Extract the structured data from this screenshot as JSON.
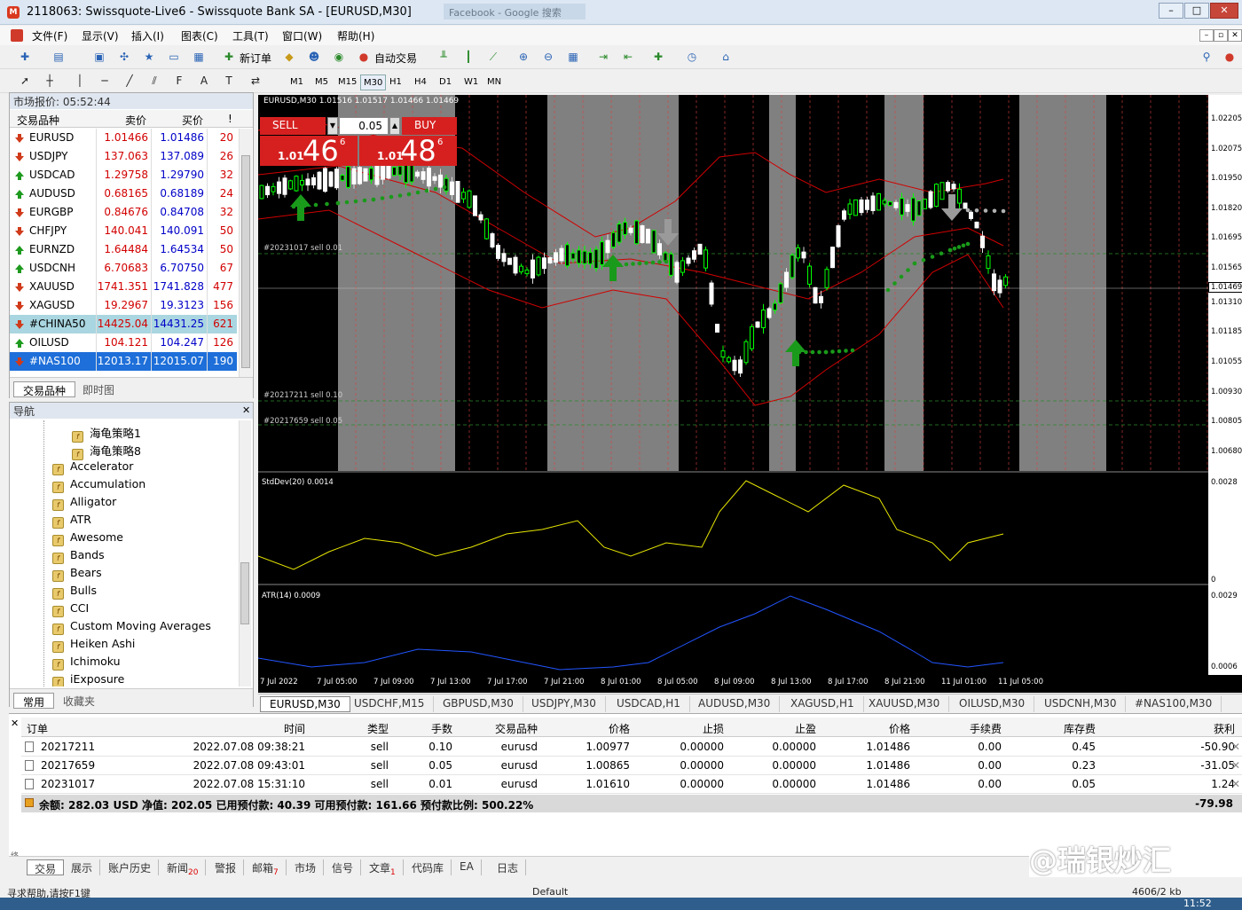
{
  "window": {
    "title": "2118063: Swissquote-Live6 - Swissquote Bank SA - [EURUSD,M30]",
    "ghost_tab": "Facebook - Google 搜索"
  },
  "menu": [
    "文件(F)",
    "显示(V)",
    "插入(I)",
    "图表(C)",
    "工具(T)",
    "窗口(W)",
    "帮助(H)"
  ],
  "toolbar": {
    "new_order": "新订单",
    "auto_trade": "自动交易"
  },
  "timeframes": [
    "M1",
    "M5",
    "M15",
    "M30",
    "H1",
    "H4",
    "D1",
    "W1",
    "MN"
  ],
  "active_timeframe": "M30",
  "market_watch": {
    "title": "市场报价: 05:52:44",
    "headers": [
      "交易品种",
      "卖价",
      "买价",
      "!"
    ],
    "rows": [
      {
        "symbol": "EURUSD",
        "bid": "1.01466",
        "ask": "1.01486",
        "spread": "20",
        "dir": "down"
      },
      {
        "symbol": "USDJPY",
        "bid": "137.063",
        "ask": "137.089",
        "spread": "26",
        "dir": "down"
      },
      {
        "symbol": "USDCAD",
        "bid": "1.29758",
        "ask": "1.29790",
        "spread": "32",
        "dir": "up"
      },
      {
        "symbol": "AUDUSD",
        "bid": "0.68165",
        "ask": "0.68189",
        "spread": "24",
        "dir": "up"
      },
      {
        "symbol": "EURGBP",
        "bid": "0.84676",
        "ask": "0.84708",
        "spread": "32",
        "dir": "down"
      },
      {
        "symbol": "CHFJPY",
        "bid": "140.041",
        "ask": "140.091",
        "spread": "50",
        "dir": "down"
      },
      {
        "symbol": "EURNZD",
        "bid": "1.64484",
        "ask": "1.64534",
        "spread": "50",
        "dir": "up"
      },
      {
        "symbol": "USDCNH",
        "bid": "6.70683",
        "ask": "6.70750",
        "spread": "67",
        "dir": "up"
      },
      {
        "symbol": "XAUUSD",
        "bid": "1741.351",
        "ask": "1741.828",
        "spread": "477",
        "dir": "down"
      },
      {
        "symbol": "XAGUSD",
        "bid": "19.2967",
        "ask": "19.3123",
        "spread": "156",
        "dir": "down"
      },
      {
        "symbol": "#CHINA50",
        "bid": "14425.04",
        "ask": "14431.25",
        "spread": "621",
        "dir": "down"
      },
      {
        "symbol": "OILUSD",
        "bid": "104.121",
        "ask": "104.247",
        "spread": "126",
        "dir": "up"
      },
      {
        "symbol": "#NAS100",
        "bid": "12013.17",
        "ask": "12015.07",
        "spread": "190",
        "dir": "down"
      }
    ],
    "tabs": [
      "交易品种",
      "即时图"
    ]
  },
  "navigator": {
    "title": "导航",
    "items": [
      "海龟策略1",
      "海龟策略8",
      "Accelerator",
      "Accumulation",
      "Alligator",
      "ATR",
      "Awesome",
      "Bands",
      "Bears",
      "Bulls",
      "CCI",
      "Custom Moving Averages",
      "Heiken Ashi",
      "Ichimoku",
      "iExposure"
    ],
    "tabs": [
      "常用",
      "收藏夹"
    ]
  },
  "chart": {
    "header": "EURUSD,M30  1.01516 1.01517 1.01466 1.01469",
    "sell_label": "SELL",
    "buy_label": "BUY",
    "lot": "0.05",
    "sell_small": "1.01",
    "sell_big": "46",
    "sell_sup": "6",
    "buy_small": "1.01",
    "buy_big": "48",
    "buy_sup": "6",
    "price_ticks": [
      "1.02205",
      "1.02075",
      "1.01950",
      "1.01820",
      "1.01695",
      "1.01565",
      "1.01310",
      "1.01185",
      "1.01055",
      "1.00930",
      "1.00805",
      "1.00680"
    ],
    "current_price": "1.01469",
    "order_labels": [
      "#20231017 sell 0.01",
      "#20217211 sell 0.10",
      "#20217659 sell 0.05"
    ],
    "stddev_label": "StdDev(20) 0.0014",
    "stddev_max": "0.0028",
    "stddev_min": "0",
    "atr_label": "ATR(14) 0.0009",
    "atr_max": "0.0029",
    "atr_min": "0.0006",
    "time_ticks": [
      "7 Jul 2022",
      "7 Jul 05:00",
      "7 Jul 09:00",
      "7 Jul 13:00",
      "7 Jul 17:00",
      "7 Jul 21:00",
      "8 Jul 01:00",
      "8 Jul 05:00",
      "8 Jul 09:00",
      "8 Jul 13:00",
      "8 Jul 17:00",
      "8 Jul 21:00",
      "11 Jul 01:00",
      "11 Jul 05:00"
    ]
  },
  "chart_tabs": [
    "EURUSD,M30",
    "USDCHF,M15",
    "GBPUSD,M30",
    "USDJPY,M30",
    "USDCAD,H1",
    "AUDUSD,M30",
    "XAGUSD,H1",
    "XAUUSD,M30",
    "OILUSD,M30",
    "USDCNH,M30",
    "#NAS100,M30"
  ],
  "terminal": {
    "headers": [
      "订单",
      "时间",
      "类型",
      "手数",
      "交易品种",
      "价格",
      "止损",
      "止盈",
      "价格",
      "手续费",
      "库存费",
      "获利"
    ],
    "rows": [
      [
        "20217211",
        "2022.07.08 09:38:21",
        "sell",
        "0.10",
        "eurusd",
        "1.00977",
        "0.00000",
        "0.00000",
        "1.01486",
        "0.00",
        "0.45",
        "-50.90"
      ],
      [
        "20217659",
        "2022.07.08 09:43:01",
        "sell",
        "0.05",
        "eurusd",
        "1.00865",
        "0.00000",
        "0.00000",
        "1.01486",
        "0.00",
        "0.23",
        "-31.05"
      ],
      [
        "20231017",
        "2022.07.08 15:31:10",
        "sell",
        "0.01",
        "eurusd",
        "1.01610",
        "0.00000",
        "0.00000",
        "1.01486",
        "0.00",
        "0.05",
        "1.24"
      ]
    ],
    "balance": "余额: 282.03 USD  净值: 202.05  已用预付款: 40.39  可用预付款: 161.66  预付款比例: 500.22%",
    "total": "-79.98",
    "tabs": [
      {
        "label": "交易",
        "badge": ""
      },
      {
        "label": "展示",
        "badge": ""
      },
      {
        "label": "账户历史",
        "badge": ""
      },
      {
        "label": "新闻",
        "badge": "20"
      },
      {
        "label": "警报",
        "badge": ""
      },
      {
        "label": "邮箱",
        "badge": "7"
      },
      {
        "label": "市场",
        "badge": ""
      },
      {
        "label": "信号",
        "badge": ""
      },
      {
        "label": "文章",
        "badge": "1"
      },
      {
        "label": "代码库",
        "badge": ""
      },
      {
        "label": "EA",
        "badge": ""
      },
      {
        "label": "日志",
        "badge": ""
      }
    ]
  },
  "status": {
    "help": "寻求帮助,请按F1键",
    "profile": "Default",
    "traffic": "4606/2 kb",
    "clock": "11:52"
  },
  "watermark": "@瑞银炒汇",
  "colors": {
    "bid": "#d20000",
    "ask": "#0000c8",
    "bull": "#00ff00",
    "band": "#d00000",
    "stddev": "#e6e600",
    "atr": "#2255ff",
    "selected_row": "#1e6fd9",
    "china_row": "#a9d6e0"
  }
}
